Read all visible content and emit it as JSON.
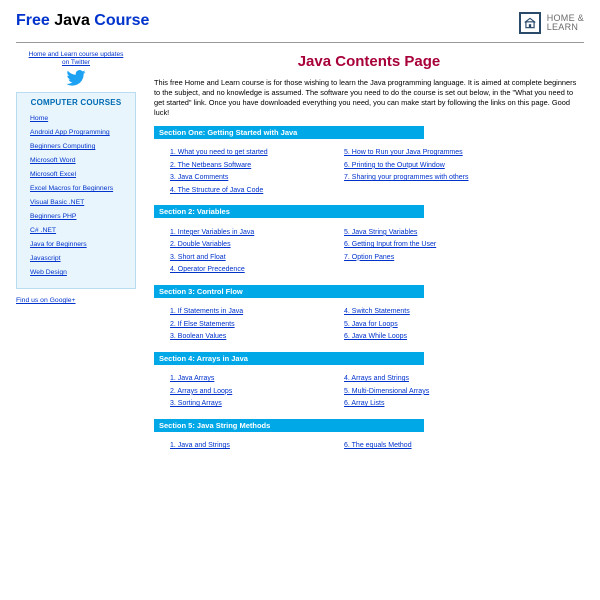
{
  "header": {
    "title_free": "Free",
    "title_java": "Java",
    "title_course": "Course",
    "logo_line1": "HOME &",
    "logo_line2": "LEARN"
  },
  "left": {
    "twitter_line1": "Home and Learn course updates",
    "twitter_line2": "on Twitter",
    "courses_title": "COMPUTER COURSES",
    "items": [
      "Home",
      "Android App Programming",
      "Beginners Computing",
      "Microsoft Word",
      "Microsoft Excel",
      "Excel Macros for Beginners",
      "Visual Basic .NET",
      "Beginners PHP",
      "C# .NET",
      "Java for Beginners",
      "Javascript",
      "Web Design"
    ],
    "google_link": "Find us on Google+"
  },
  "main": {
    "title": "Java Contents Page",
    "intro": "This free Home and Learn course is for those wishing to learn the Java programming language. It is aimed at complete beginners to the subject, and no knowledge is assumed. The software you need to do the course is set out below, in the \"What you need to get started\" link. Once you have downloaded everything you need, you can make start by following the links on this page. Good luck!"
  },
  "sections": [
    {
      "label": "Section One: Getting Started with Java",
      "left": [
        "1. What you need to get started",
        "2. The Netbeans Software",
        "3. Java Comments",
        "4. The Structure of Java Code"
      ],
      "right": [
        "5. How to Run your Java Programmes",
        "6. Printing to the Output Window",
        "7. Sharing your programmes with others"
      ]
    },
    {
      "label": "Section 2: Variables",
      "left": [
        "1. Integer Variables in Java",
        "2. Double Variables",
        "3. Short and Float",
        "4. Operator  Precedence"
      ],
      "right": [
        "5. Java String Variables",
        "6. Getting Input from the User",
        "7. Option Panes"
      ]
    },
    {
      "label": "Section 3: Control Flow",
      "left": [
        "1. If Statements in Java",
        "2. If Else Statements",
        "3. Boolean Values"
      ],
      "right": [
        "4. Switch Statements",
        "5. Java for Loops",
        "6. Java While Loops"
      ]
    },
    {
      "label": "Section 4: Arrays in Java",
      "left": [
        "1. Java Arrays",
        "2. Arrays and Loops",
        "3. Sorting Arrays"
      ],
      "right": [
        "4. Arrays and Strings",
        "5. Multi-Dimensional Arrays",
        "6. Array Lists"
      ]
    },
    {
      "label": "Section 5: Java String Methods",
      "left": [
        "1. Java and Strings"
      ],
      "right": [
        "6. The equals Method"
      ]
    }
  ]
}
